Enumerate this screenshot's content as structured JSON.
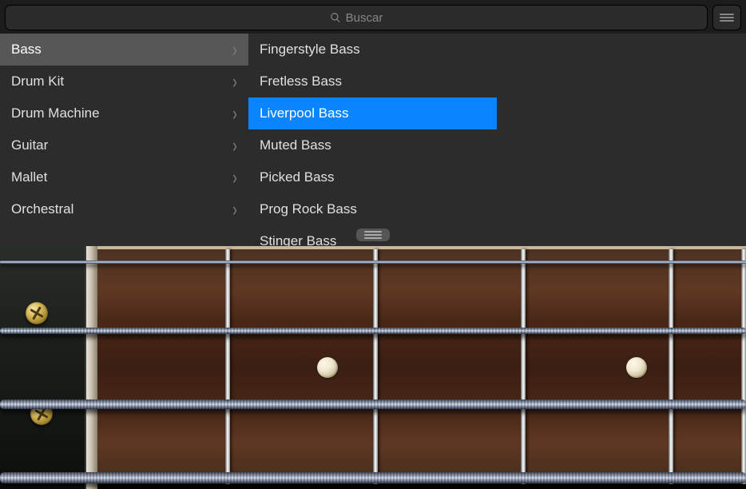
{
  "search": {
    "placeholder": "Buscar",
    "icon": "search-icon"
  },
  "categories": {
    "items": [
      {
        "label": "Bass",
        "selected": true
      },
      {
        "label": "Drum Kit",
        "selected": false
      },
      {
        "label": "Drum Machine",
        "selected": false
      },
      {
        "label": "Guitar",
        "selected": false
      },
      {
        "label": "Mallet",
        "selected": false
      },
      {
        "label": "Orchestral",
        "selected": false
      }
    ]
  },
  "presets": {
    "items": [
      {
        "label": "Fingerstyle Bass",
        "selected": false
      },
      {
        "label": "Fretless Bass",
        "selected": false
      },
      {
        "label": "Liverpool Bass",
        "selected": true
      },
      {
        "label": "Muted Bass",
        "selected": false
      },
      {
        "label": "Picked Bass",
        "selected": false
      },
      {
        "label": "Prog Rock Bass",
        "selected": false
      },
      {
        "label": "Stinger Bass",
        "selected": false
      }
    ]
  },
  "instrument": {
    "type": "bass",
    "string_count": 4,
    "visible_frets": 5,
    "inlay_frets": [
      2,
      4
    ]
  }
}
